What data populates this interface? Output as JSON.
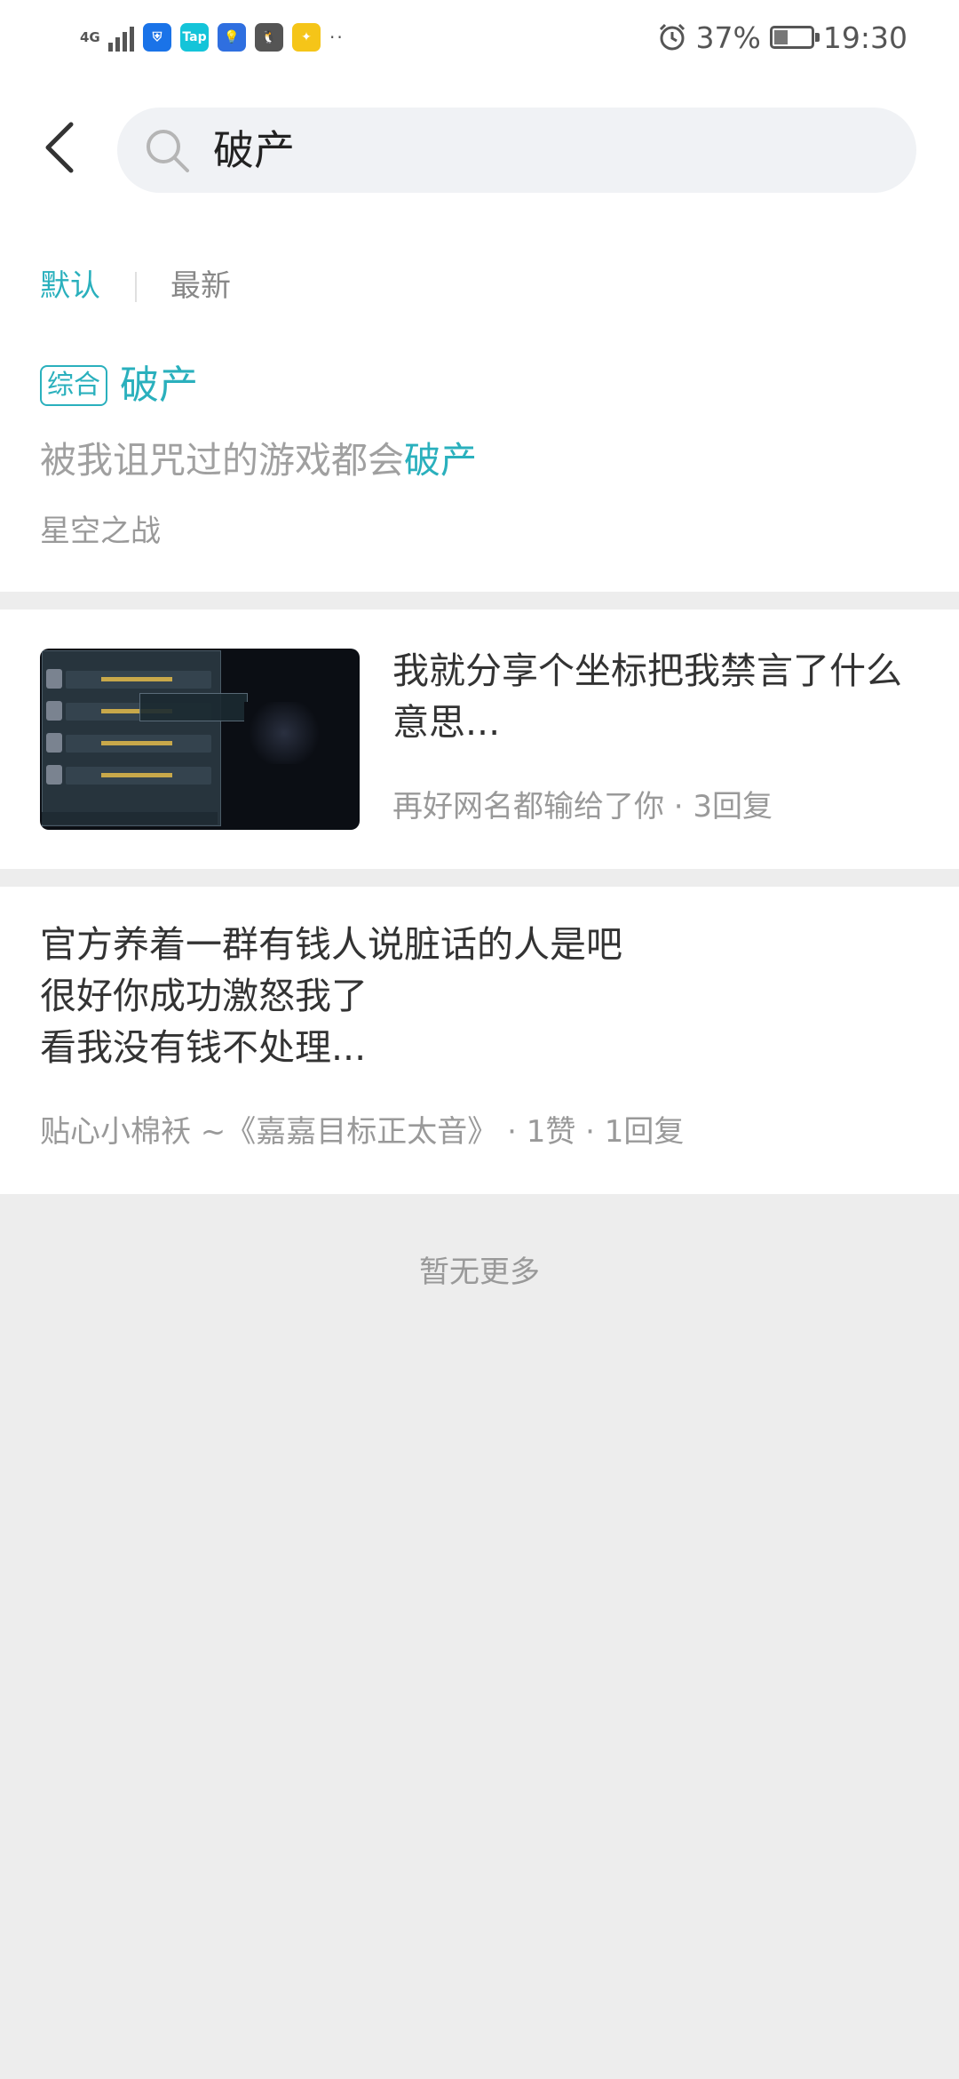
{
  "status_bar": {
    "network": "4G",
    "app_icons": [
      {
        "name": "shield-app-icon",
        "color": "#1a73e8",
        "glyph": "⛨"
      },
      {
        "name": "taptap-app-icon",
        "color": "#14c4d9",
        "glyph": "Tap"
      },
      {
        "name": "bulb-app-icon",
        "color": "#2f6fe0",
        "glyph": "💡"
      },
      {
        "name": "qq-app-icon",
        "color": "#555555",
        "glyph": "🐧"
      },
      {
        "name": "game-app-icon",
        "color": "#f5c518",
        "glyph": "✦"
      }
    ],
    "overflow": "··",
    "battery_percent": "37%",
    "battery_level": 0.37,
    "time": "19:30"
  },
  "search": {
    "query": "破产"
  },
  "filters": {
    "default": "默认",
    "latest": "最新",
    "active": "default"
  },
  "topic_card": {
    "badge": "综合",
    "title": "破产",
    "subtitle_prefix": "被我诅咒过的游戏都会",
    "subtitle_highlight": "破产",
    "source": "星空之战"
  },
  "post1": {
    "title": "我就分享个坐标把我禁言了什么意思...",
    "meta": "再好网名都输给了你 · 3回复"
  },
  "post2": {
    "lines": [
      "官方养着一群有钱人说脏话的人是吧",
      "很好你成功激怒我了",
      "看我没有钱不处理..."
    ],
    "meta": "贴心小棉袄 ~《嘉嘉目标正太音》 · 1赞 · 1回复"
  },
  "footer": {
    "no_more": "暂无更多"
  },
  "colors": {
    "accent": "#2ab0bd",
    "background": "#ededed"
  }
}
